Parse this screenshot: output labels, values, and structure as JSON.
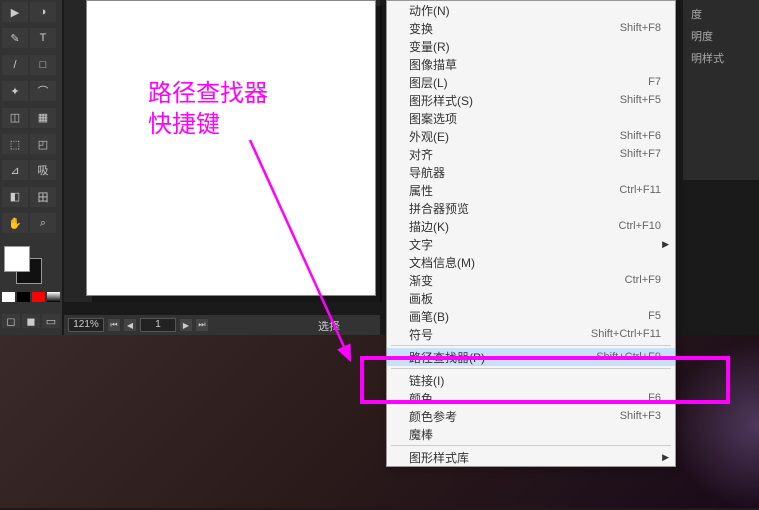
{
  "annotation": {
    "line1": "路径查找器",
    "line2": "快捷键"
  },
  "zoom": {
    "value": "121%",
    "page": "1"
  },
  "status": "选择",
  "right_panel": {
    "items": [
      "度",
      "明度",
      "明样式"
    ]
  },
  "menu": {
    "items": [
      {
        "label": "动作(N)",
        "shortcut": "",
        "arrow": false
      },
      {
        "label": "变换",
        "shortcut": "Shift+F8",
        "arrow": false
      },
      {
        "label": "变量(R)",
        "shortcut": "",
        "arrow": false
      },
      {
        "label": "图像描草",
        "shortcut": "",
        "arrow": false
      },
      {
        "label": "图层(L)",
        "shortcut": "F7",
        "arrow": false
      },
      {
        "label": "图形样式(S)",
        "shortcut": "Shift+F5",
        "arrow": false
      },
      {
        "label": "图案选项",
        "shortcut": "",
        "arrow": false
      },
      {
        "label": "外观(E)",
        "shortcut": "Shift+F6",
        "arrow": false
      },
      {
        "label": "对齐",
        "shortcut": "Shift+F7",
        "arrow": false
      },
      {
        "label": "导航器",
        "shortcut": "",
        "arrow": false
      },
      {
        "label": "属性",
        "shortcut": "Ctrl+F11",
        "arrow": false
      },
      {
        "label": "拼合器预览",
        "shortcut": "",
        "arrow": false
      },
      {
        "label": "描边(K)",
        "shortcut": "Ctrl+F10",
        "arrow": false
      },
      {
        "label": "文字",
        "shortcut": "",
        "arrow": true
      },
      {
        "label": "文档信息(M)",
        "shortcut": "",
        "arrow": false
      },
      {
        "label": "渐变",
        "shortcut": "Ctrl+F9",
        "arrow": false
      },
      {
        "label": "画板",
        "shortcut": "",
        "arrow": false
      },
      {
        "label": "画笔(B)",
        "shortcut": "F5",
        "arrow": false
      },
      {
        "label": "符号",
        "shortcut": "Shift+Ctrl+F11",
        "arrow": false
      },
      {
        "sep": true
      },
      {
        "label": "路径查找器(P)",
        "shortcut": "Shift+Ctrl+F9",
        "arrow": false,
        "hl": true
      },
      {
        "sep": true
      },
      {
        "label": "链接(I)",
        "shortcut": "",
        "arrow": false
      },
      {
        "label": "颜色",
        "shortcut": "F6",
        "arrow": false
      },
      {
        "label": "颜色参考",
        "shortcut": "Shift+F3",
        "arrow": false
      },
      {
        "label": "魔棒",
        "shortcut": "",
        "arrow": false
      },
      {
        "sep": true
      },
      {
        "label": "图形样式库",
        "shortcut": "",
        "arrow": true
      }
    ]
  },
  "tool_icons": [
    "▶",
    "◑",
    "✎",
    "T",
    "/",
    "□",
    "✦",
    "⌒",
    "◫",
    "▦",
    "⬚",
    "◰",
    "⊿",
    "吸",
    "◧",
    "田",
    "✋",
    "⌕"
  ]
}
